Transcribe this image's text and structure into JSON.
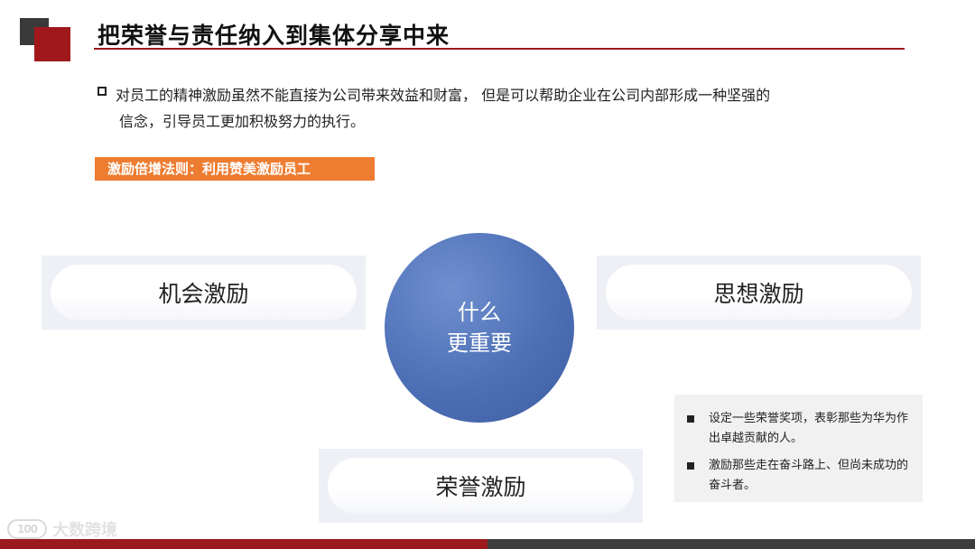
{
  "slide": {
    "title": "把荣誉与责任纳入到集体分享中来",
    "intro_line1": "对员工的精神激励虽然不能直接为公司带来效益和财富，  但是可以帮助企业在公司内部形成一种坚强的",
    "intro_line2": "信念，引导员工更加积极努力的执行。",
    "section_tag": "激励倍增法则：利用赞美激励员工",
    "center_line1": "什么",
    "center_line2": "更重要",
    "cards": {
      "left": "机会激励",
      "right": "思想激励",
      "bottom": "荣誉激励"
    },
    "notes": [
      "设定一些荣誉奖项，表彰那些为华为作出卓越贡献的人。",
      "激励那些走在奋斗路上、但尚未成功的奋斗者。"
    ]
  },
  "watermark": {
    "badge": "100",
    "text": "大数跨境"
  },
  "colors": {
    "accent_red": "#9a1a1e",
    "accent_orange": "#ee7d31",
    "circle_blue": "#4d6fb5"
  }
}
